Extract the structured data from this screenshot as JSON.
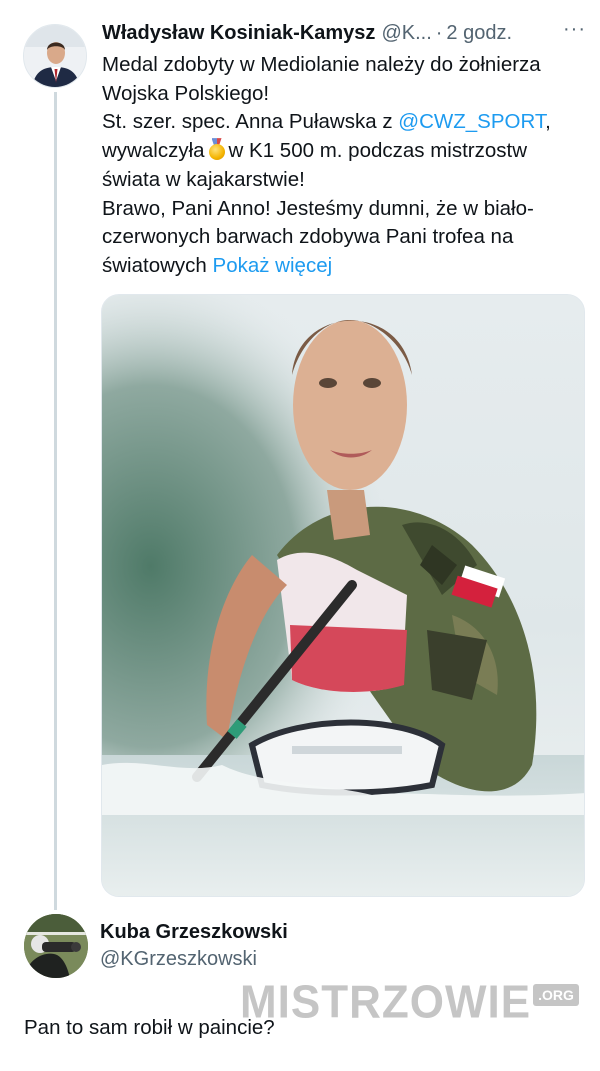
{
  "tweet": {
    "author_name": "Władysław Kosiniak-Kamysz",
    "author_handle": "@K...",
    "separator": "·",
    "time": "2 godz.",
    "more": "···",
    "lines": [
      "Medal zdobyty w Mediolanie należy do żołnierza",
      "Wojska Polskiego!",
      "St. szer. spec. Anna Puławska z ",
      "@CWZ_SPORT",
      ",",
      "wywalczyła",
      "w K1 500 m. podczas mistrzostw",
      "świata w kajakarstwie!",
      "Brawo, Pani Anno! Jesteśmy dumni, że w biało-",
      "czerwonych barwach zdobywa Pani trofea na",
      "światowych ",
      "Pokaż więcej"
    ],
    "medal_icon": "gold-medal-emoji",
    "media_alt_icon": "kayaker-photo"
  },
  "reply": {
    "author_name": "Kuba Grzeszkowski",
    "author_handle": "@KGrzeszkowski",
    "text": "Pan to sam robił w paincie?"
  },
  "watermark": {
    "text": "MISTRZOWIE",
    "badge": ".ORG"
  },
  "colors": {
    "link": "#1d9bf0",
    "text": "#0f1419",
    "secondary": "#536471",
    "thread_line": "#cfd9de"
  }
}
